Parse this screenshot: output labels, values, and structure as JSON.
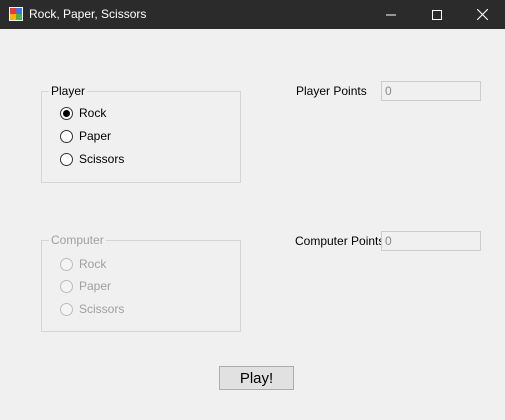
{
  "window": {
    "title": "Rock, Paper, Scissors",
    "controls": {
      "minimize_icon": "minimize-icon",
      "maximize_icon": "maximize-icon",
      "close_icon": "close-icon"
    }
  },
  "player": {
    "group_label": "Player",
    "options": [
      {
        "label": "Rock",
        "checked": true
      },
      {
        "label": "Paper",
        "checked": false
      },
      {
        "label": "Scissors",
        "checked": false
      }
    ]
  },
  "computer": {
    "group_label": "Computer",
    "enabled": false,
    "options": [
      {
        "label": "Rock",
        "checked": false
      },
      {
        "label": "Paper",
        "checked": false
      },
      {
        "label": "Scissors",
        "checked": false
      }
    ]
  },
  "scores": {
    "player_label": "Player Points",
    "player_value": "0",
    "computer_label": "Computer Points",
    "computer_value": "0"
  },
  "actions": {
    "play_label": "Play!"
  }
}
